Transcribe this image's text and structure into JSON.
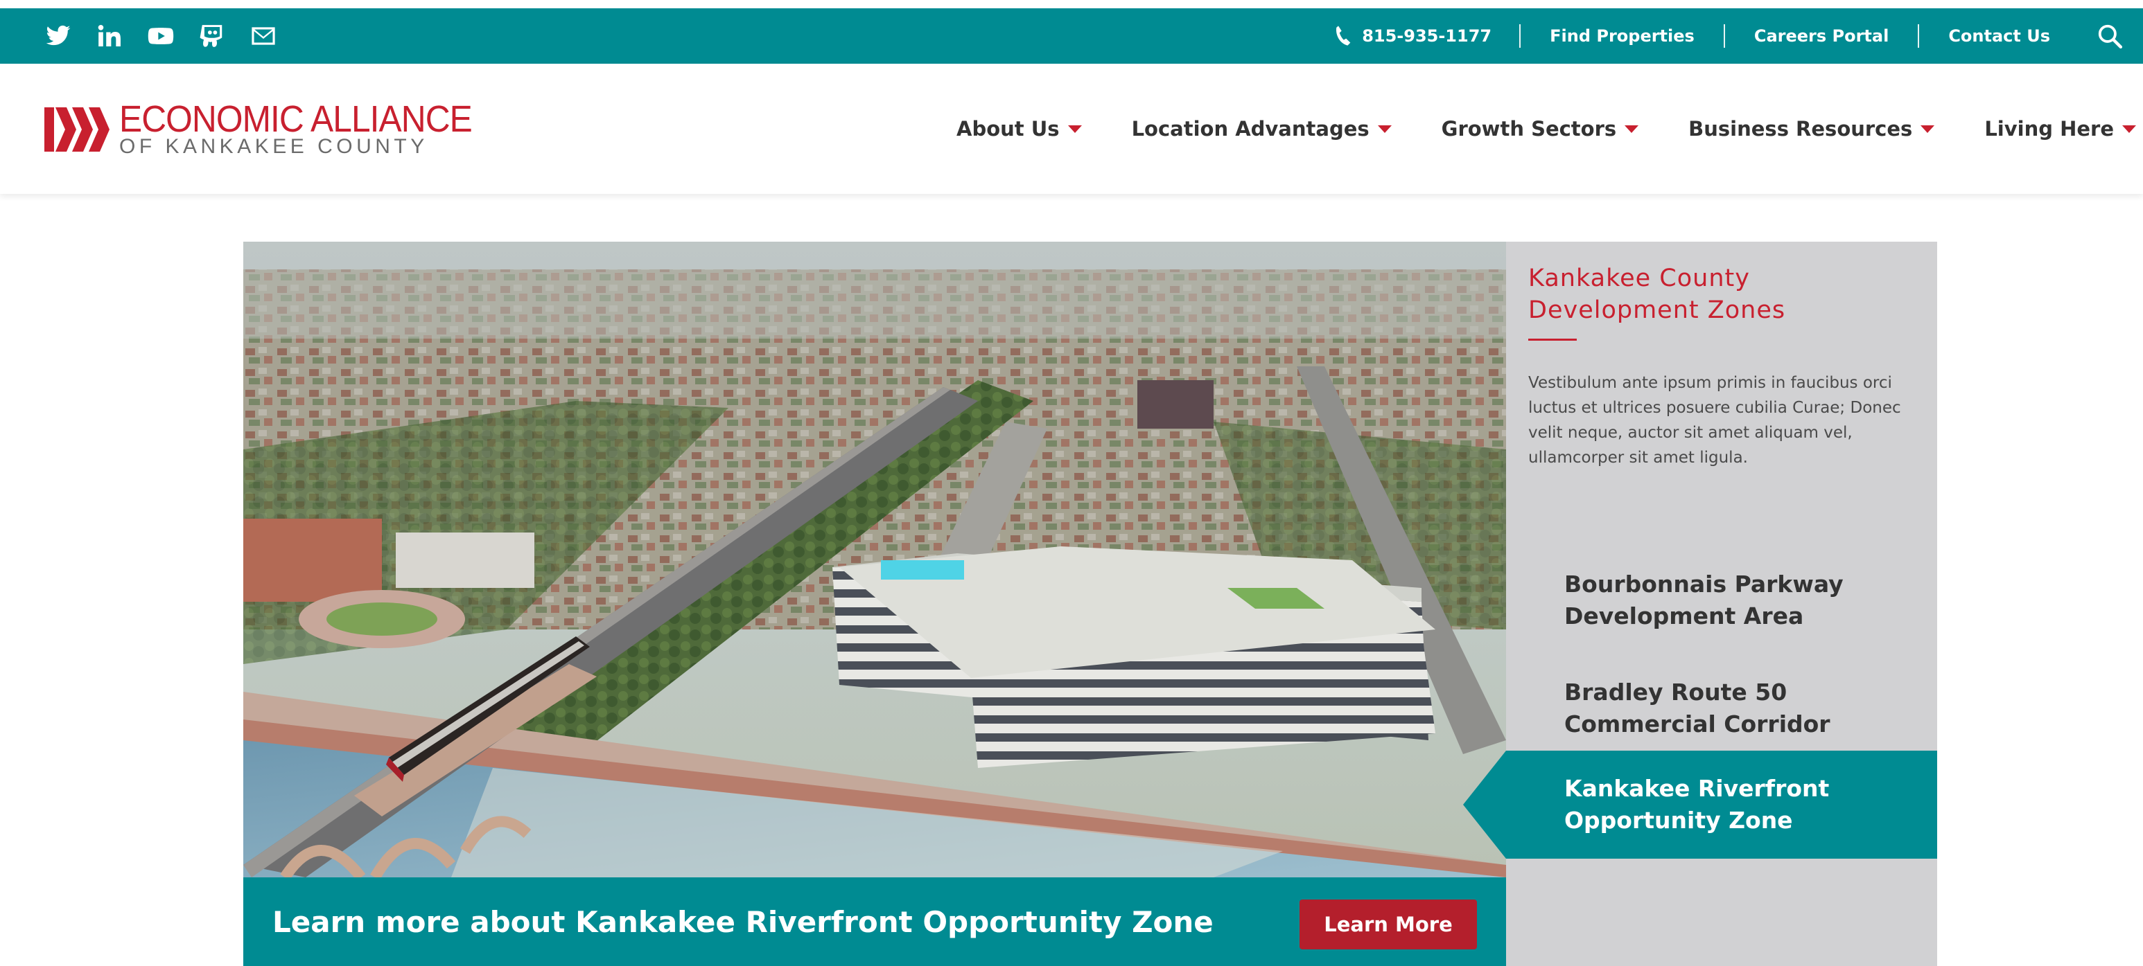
{
  "utility_bar": {
    "social_icons": [
      "twitter-icon",
      "linkedin-icon",
      "youtube-icon",
      "slideshare-icon",
      "email-icon"
    ],
    "phone": "815-935-1177",
    "links": [
      "Find Properties",
      "Careers Portal",
      "Contact Us"
    ],
    "background_color": "#008b92"
  },
  "logo": {
    "line1": "ECONOMIC ALLIANCE",
    "line2": "OF KANKAKEE COUNTY",
    "brand_color": "#c8202f"
  },
  "nav": {
    "items": [
      "About Us",
      "Location Advantages",
      "Growth Sectors",
      "Business Resources",
      "Living Here"
    ]
  },
  "hero": {
    "cta_text": "Learn more about Kankakee Riverfront Opportunity Zone",
    "cta_button": "Learn More"
  },
  "panel": {
    "title": "Kankakee County Development Zones",
    "body": "Vestibulum ante ipsum primis in faucibus orci luctus et ultrices posuere cubilia Curae; Donec velit neque, auctor sit amet aliquam vel, ullamcorper sit amet ligula.",
    "zones": [
      {
        "label": "Bourbonnais Parkway Development Area",
        "active": false
      },
      {
        "label": "Bradley Route 50 Commercial Corridor",
        "active": false
      },
      {
        "label": "Kankakee Riverfront Opportunity Zone",
        "active": true
      }
    ]
  }
}
